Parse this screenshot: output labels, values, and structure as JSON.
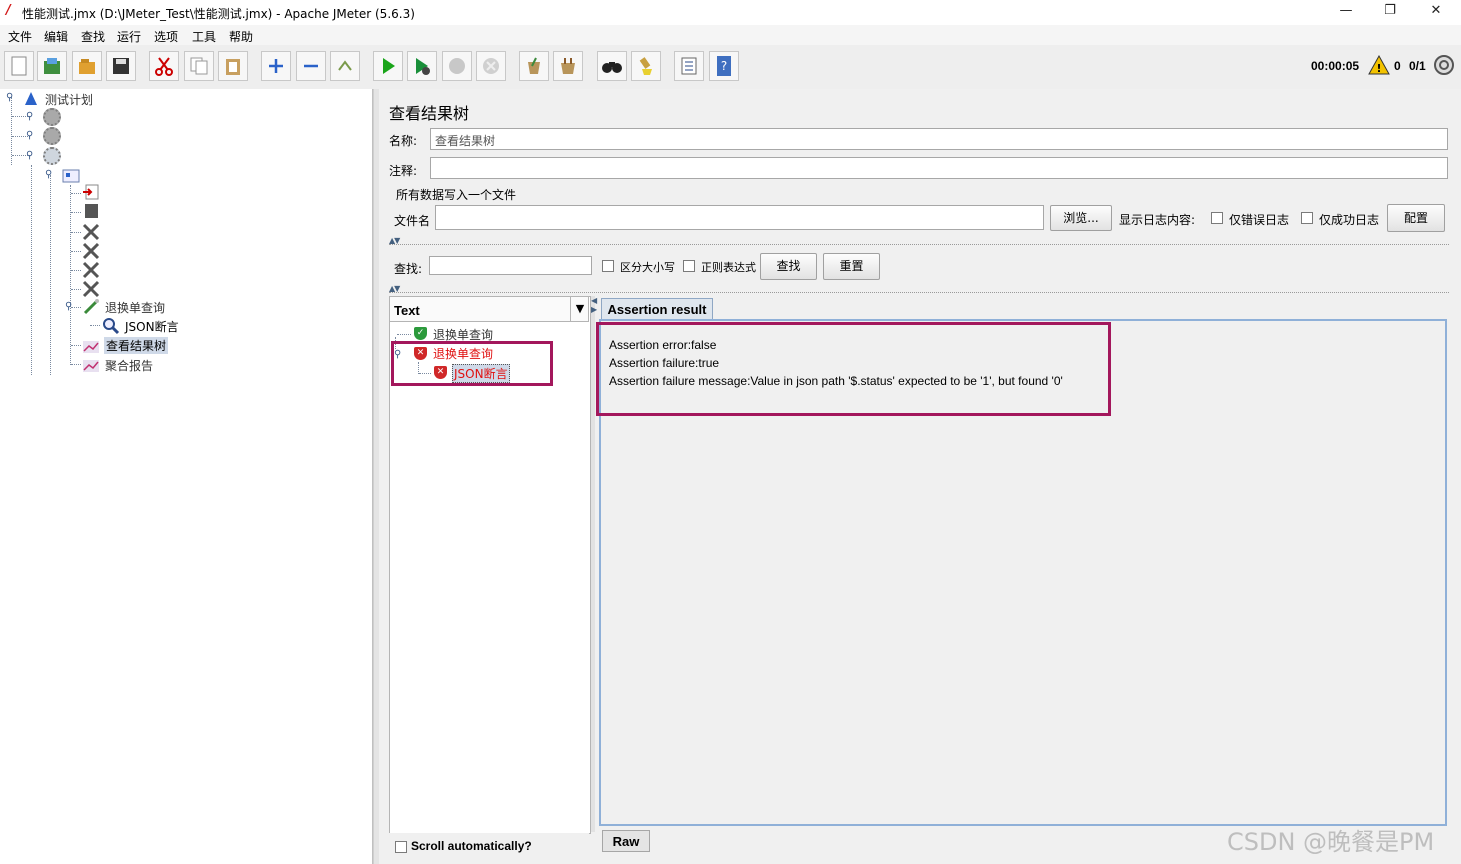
{
  "window": {
    "title": "性能测试.jmx (D:\\JMeter_Test\\性能测试.jmx) - Apache JMeter (5.6.3)",
    "controls": [
      "—",
      "❐",
      "✕"
    ]
  },
  "menu": [
    "文件",
    "编辑",
    "查找",
    "运行",
    "选项",
    "工具",
    "帮助"
  ],
  "toolbar": {
    "buttons": [
      "new-icon",
      "templates-icon",
      "open-icon",
      "save-icon",
      "cut-icon",
      "copy-icon",
      "paste-icon",
      "expand-icon",
      "collapse-icon",
      "toggle-icon",
      "start-icon",
      "start-no-pause-icon",
      "stop-icon",
      "shutdown-icon",
      "clear-icon",
      "clear-all-icon",
      "search-icon",
      "reset-search-icon",
      "function-helper-icon",
      "help-icon"
    ],
    "timer": "00:00:05",
    "warnings": "0",
    "threads": "0/1"
  },
  "tree": {
    "root": "测试计划",
    "nodes": [
      {
        "label": "退换单查询",
        "icon": "sampler-icon"
      },
      {
        "label": "JSON断言",
        "icon": "assertion-icon"
      },
      {
        "label": "查看结果树",
        "icon": "listener-icon",
        "selected": true
      },
      {
        "label": "聚合报告",
        "icon": "listener-icon"
      }
    ]
  },
  "panel": {
    "title": "查看结果树",
    "name_label": "名称:",
    "name_value": "查看结果树",
    "comment_label": "注释:",
    "comment_value": "",
    "file_group": "所有数据写入一个文件",
    "filename_label": "文件名",
    "filename_value": "",
    "browse_button": "浏览...",
    "log_label": "显示日志内容:",
    "errors_only": "仅错误日志",
    "success_only": "仅成功日志",
    "config_button": "配置",
    "search_label": "查找:",
    "search_value": "",
    "case_sensitive": "区分大小写",
    "regex": "正则表达式",
    "find_button": "查找",
    "reset_button": "重置"
  },
  "results": {
    "renderer": "Text",
    "items": [
      {
        "label": "退换单查询",
        "status": "success"
      },
      {
        "label": "退换单查询",
        "status": "error"
      },
      {
        "label": "JSON断言",
        "status": "error"
      }
    ],
    "scroll_auto": "Scroll automatically?",
    "tab": "Assertion result",
    "raw_tab": "Raw",
    "lines": [
      "Assertion error:false",
      "Assertion failure:true",
      "Assertion failure message:Value in json path '$.status' expected to be '1', but found '0'"
    ]
  },
  "watermark": "CSDN @晚餐是PM"
}
